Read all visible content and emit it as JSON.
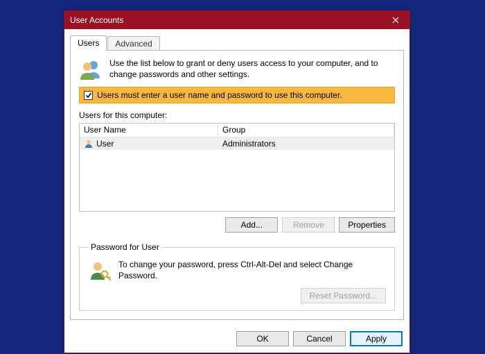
{
  "window": {
    "title": "User Accounts"
  },
  "tabs": {
    "users": "Users",
    "advanced": "Advanced"
  },
  "intro": "Use the list below to grant or deny users access to your computer, and to change passwords and other settings.",
  "checkbox": {
    "label": "Users must enter a user name and password to use this computer.",
    "checked": true
  },
  "list": {
    "caption": "Users for this computer:",
    "columns": {
      "name": "User Name",
      "group": "Group"
    },
    "rows": [
      {
        "name": "User",
        "group": "Administrators"
      }
    ]
  },
  "buttons": {
    "add": "Add...",
    "remove": "Remove",
    "properties": "Properties",
    "resetPassword": "Reset Password...",
    "ok": "OK",
    "cancel": "Cancel",
    "apply": "Apply"
  },
  "passwordGroup": {
    "legend": "Password for User",
    "text": "To change your password, press Ctrl-Alt-Del and select Change Password."
  }
}
